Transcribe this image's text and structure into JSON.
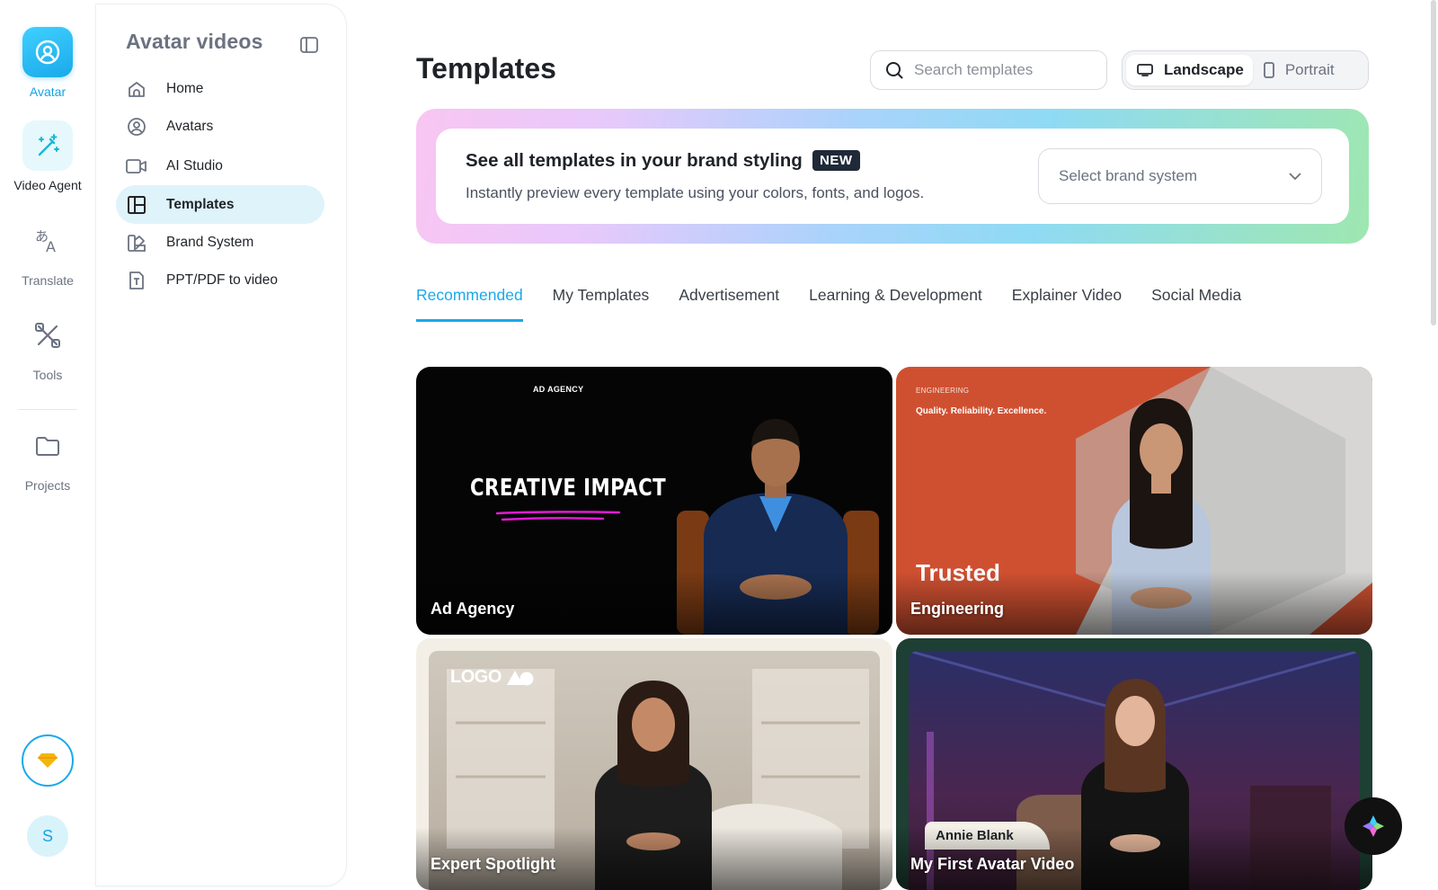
{
  "rail": {
    "items": [
      {
        "label": "Avatar",
        "icon": "avatar-icon",
        "active": true
      },
      {
        "label": "Video Agent",
        "icon": "magic-wand-icon"
      },
      {
        "label": "Translate",
        "icon": "translate-icon"
      },
      {
        "label": "Tools",
        "icon": "tools-icon"
      },
      {
        "label": "Projects",
        "icon": "folder-icon"
      }
    ],
    "upgrade_icon": "diamond-icon",
    "user_initial": "S"
  },
  "sidebar": {
    "title": "Avatar videos",
    "items": [
      {
        "label": "Home",
        "icon": "home-icon"
      },
      {
        "label": "Avatars",
        "icon": "user-circle-icon"
      },
      {
        "label": "AI Studio",
        "icon": "video-camera-icon"
      },
      {
        "label": "Templates",
        "icon": "layout-icon",
        "active": true
      },
      {
        "label": "Brand System",
        "icon": "palette-icon"
      },
      {
        "label": "PPT/PDF to video",
        "icon": "document-icon"
      }
    ]
  },
  "main": {
    "title": "Templates",
    "search_placeholder": "Search templates",
    "orientation": {
      "options": [
        "Landscape",
        "Portrait"
      ],
      "selected": "Landscape"
    },
    "promo": {
      "title": "See all templates in your brand styling",
      "badge": "NEW",
      "subtitle": "Instantly preview every template using your colors, fonts, and logos.",
      "select_placeholder": "Select brand system"
    },
    "tabs": [
      "Recommended",
      "My Templates",
      "Advertisement",
      "Learning & Development",
      "Explainer Video",
      "Social Media"
    ],
    "active_tab": "Recommended",
    "cards": [
      {
        "label": "Ad Agency",
        "tag": "AD AGENCY",
        "headline": "CREATIVE IMPACT"
      },
      {
        "label": "Engineering",
        "tag": "ENGINEERING",
        "tagline": "Quality. Reliability. Excellence.",
        "headline": "Trusted"
      },
      {
        "label": "Expert Spotlight",
        "logo_text": "LOGO"
      },
      {
        "label": "My First Avatar Video",
        "name_tag": "Annie Blank"
      }
    ]
  },
  "colors": {
    "accent": "#1aa9ea",
    "active_bg": "#dff3fa",
    "engineering_orange": "#cf5031"
  }
}
